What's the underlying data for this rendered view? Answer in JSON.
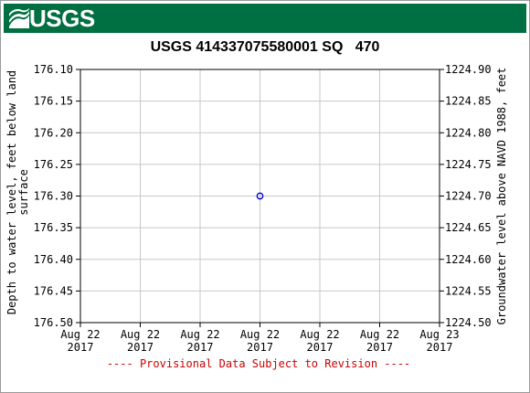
{
  "header": {
    "logo_text": "USGS"
  },
  "chart_data": {
    "type": "scatter",
    "title": "USGS 414337075580001 SQ   470",
    "ylabel_left": [
      "Depth to water level, feet below land",
      "surface"
    ],
    "ylabel_right": "Groundwater level above NAVD 1988, feet",
    "y_left_range": [
      176.1,
      176.5
    ],
    "y_left_inverted": true,
    "y_right_range": [
      1224.5,
      1224.9
    ],
    "y_left_ticks": [
      "176.10",
      "176.15",
      "176.20",
      "176.25",
      "176.30",
      "176.35",
      "176.40",
      "176.45",
      "176.50"
    ],
    "y_right_ticks": [
      "1224.90",
      "1224.85",
      "1224.80",
      "1224.75",
      "1224.70",
      "1224.65",
      "1224.60",
      "1224.55",
      "1224.50"
    ],
    "x_ticks": [
      [
        "Aug 22",
        "2017"
      ],
      [
        "Aug 22",
        "2017"
      ],
      [
        "Aug 22",
        "2017"
      ],
      [
        "Aug 22",
        "2017"
      ],
      [
        "Aug 22",
        "2017"
      ],
      [
        "Aug 22",
        "2017"
      ],
      [
        "Aug 23",
        "2017"
      ]
    ],
    "grid": true,
    "points": [
      {
        "x_fraction_of_day": 0.5,
        "depth": 176.3,
        "elevation": 1224.7
      }
    ],
    "marker_color": "#0000cc"
  },
  "footer": {
    "provisional": "---- Provisional Data Subject to Revision ----"
  }
}
